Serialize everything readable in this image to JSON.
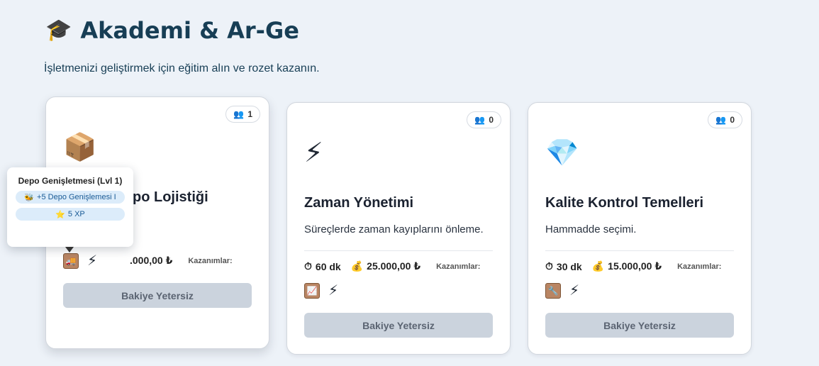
{
  "header": {
    "icon": "graduation-cap-icon",
    "icon_glyph": "🎓",
    "title": "Akademi & Ar-Ge",
    "subtitle": "İşletmenizi geliştirmek için eğitim alın ve rozet kazanın."
  },
  "cards": [
    {
      "participants": "1",
      "icon_glyph": "📦",
      "icon": "package-icon",
      "title": "Depo Lojistiği",
      "title_visible": "po Lojistiği",
      "description": "",
      "duration": "",
      "cost": ".000,00 ₺",
      "earnings_label": "Kazanımlar:",
      "button_label": "Bakiye Yetersiz",
      "tooltip": {
        "title": "Depo Genişletmesi (Lvl 1)",
        "perk": "+5 Depo Genişlemesi I",
        "xp": "5 XP"
      }
    },
    {
      "participants": "0",
      "icon_glyph": "⚡",
      "icon": "lightning-icon",
      "title": "Zaman Yönetimi",
      "description": "Süreçlerde zaman kayıplarını önleme.",
      "duration": "60 dk",
      "cost": "25.000,00 ₺",
      "earnings_label": "Kazanımlar:",
      "button_label": "Bakiye Yetersiz"
    },
    {
      "participants": "0",
      "icon_glyph": "💎",
      "icon": "diamond-icon",
      "title": "Kalite Kontrol Temelleri",
      "description": "Hammadde seçimi.",
      "duration": "30 dk",
      "cost": "15.000,00 ₺",
      "earnings_label": "Kazanımlar:",
      "button_label": "Bakiye Yetersiz"
    }
  ],
  "colors": {
    "background": "#edf2f8",
    "title": "#173e55",
    "button_disabled": "#cbd3dd",
    "chip": "#dcecfa"
  }
}
